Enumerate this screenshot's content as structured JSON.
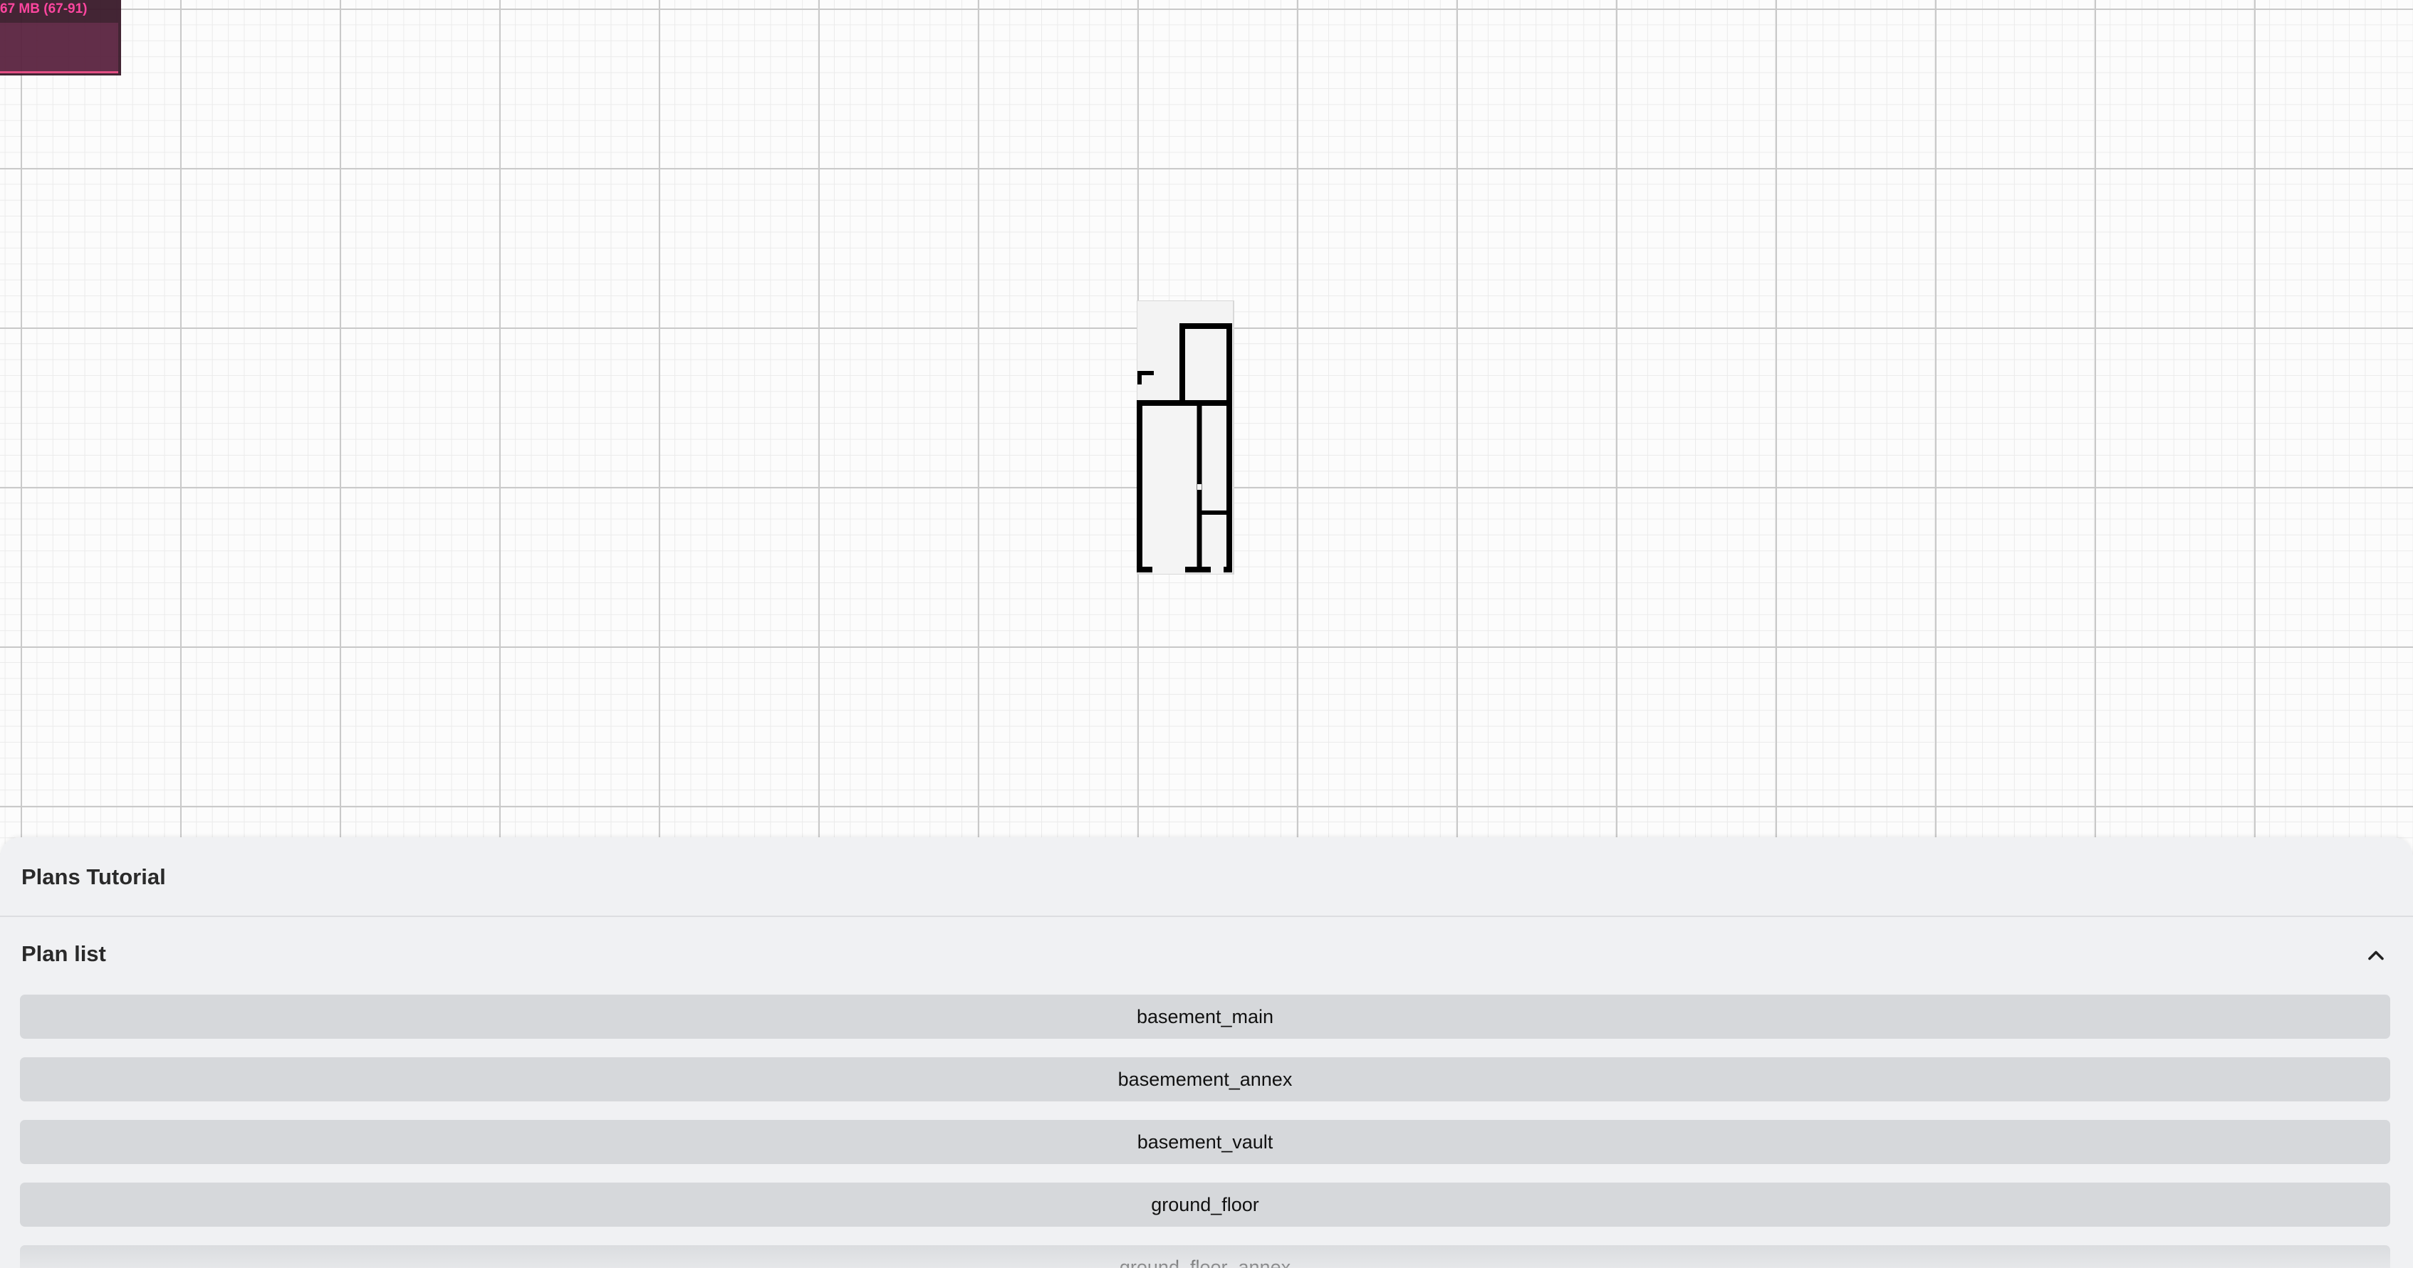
{
  "stats": {
    "label": "67 MB (67-91)"
  },
  "panel": {
    "title": "Plans Tutorial",
    "plan_list": {
      "title": "Plan list",
      "expanded": true,
      "plans": [
        {
          "label": "basement_main"
        },
        {
          "label": "basemement_annex"
        },
        {
          "label": "basement_vault"
        },
        {
          "label": "ground_floor"
        },
        {
          "label": "ground_floor_annex"
        }
      ]
    }
  },
  "icons": {
    "collapse": "chevron-up-icon"
  },
  "colors": {
    "panel_bg": "#f0f1f3",
    "button_bg": "#d6d8db",
    "stats_text": "#ff3d9b",
    "wall": "#000000"
  }
}
